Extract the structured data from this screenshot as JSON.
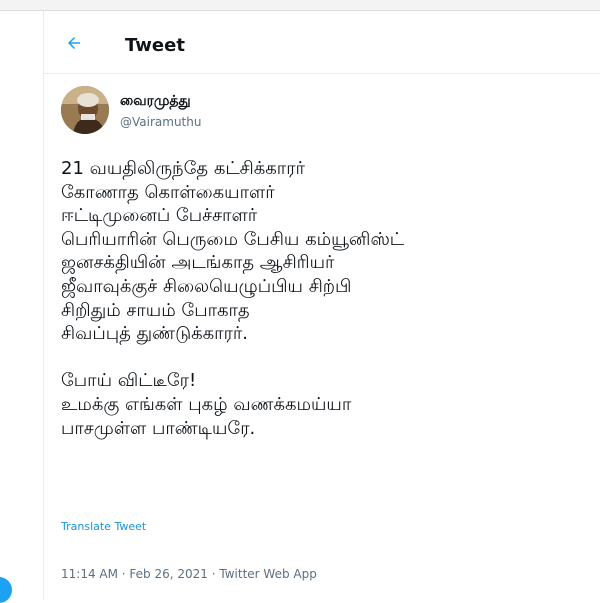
{
  "header": {
    "title": "Tweet"
  },
  "author": {
    "display_name": "வைரமுத்து",
    "handle": "@Vairamuthu"
  },
  "tweet": {
    "lines": [
      "21 வயதிலிருந்தே கட்சிக்காரர்",
      "கோணாத கொள்கையாளர்",
      "ஈட்டிமுனைப் பேச்சாளர்",
      "பெரியாரின் பெருமை பேசிய கம்யூனிஸ்ட்",
      "ஜனசக்தியின் அடங்காத ஆசிரியர்",
      "ஜீவாவுக்குச் சிலையெழுப்பிய சிற்பி",
      "சிறிதும் சாயம் போகாத",
      "சிவப்புத் துண்டுக்காரர்.",
      "",
      "போய் விட்டீரே!",
      "உமக்கு எங்கள் புகழ் வணக்கமய்யா",
      "பாசமுள்ள பாண்டியரே."
    ],
    "translate_label": "Translate Tweet",
    "time": "11:14 AM",
    "date": "Feb 26, 2021",
    "source": "Twitter Web App",
    "separator": " · "
  },
  "icons": {
    "back": "arrow-left-icon"
  },
  "colors": {
    "accent": "#1da1f2",
    "link": "#1b95e0",
    "text": "#0f1419",
    "muted": "#5b7083"
  }
}
